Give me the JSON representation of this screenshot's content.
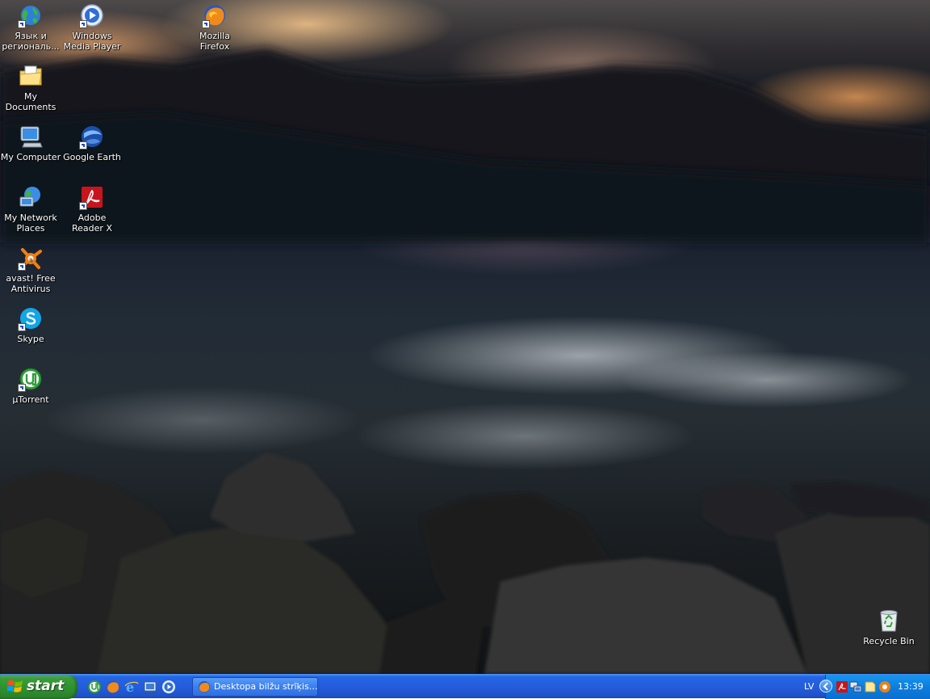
{
  "desktop": {
    "icons": [
      {
        "label": "Язык и региональ..."
      },
      {
        "label": "Windows Media Player"
      },
      {
        "label": "Mozilla Firefox"
      },
      {
        "label": "My Documents"
      },
      {
        "label": "My Computer"
      },
      {
        "label": "Google Earth"
      },
      {
        "label": "My Network Places"
      },
      {
        "label": "Adobe Reader X"
      },
      {
        "label": "avast! Free Antivirus"
      },
      {
        "label": "Skype"
      },
      {
        "label": "µTorrent"
      },
      {
        "label": "Recycle Bin"
      }
    ]
  },
  "taskbar": {
    "start_label": "start",
    "quick_launch": [
      "utorrent-icon",
      "firefox-icon",
      "internet-explorer-icon",
      "desktop-icon",
      "media-player-icon"
    ],
    "task_window_label": "Desktopa bilžu strīķis.…",
    "language": "LV",
    "clock": "13:39",
    "colors": {
      "taskbar": "#245ddb",
      "start": "#3a9c3a",
      "tray": "#0c7ee0"
    }
  }
}
